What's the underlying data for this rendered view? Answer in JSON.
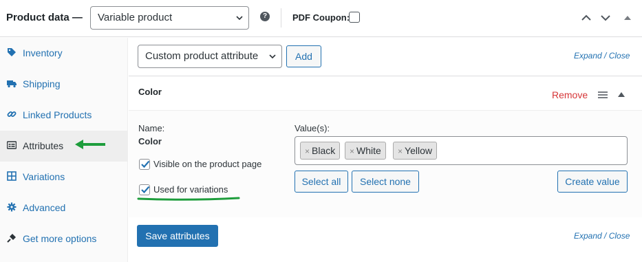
{
  "header": {
    "title": "Product data —",
    "product_type": "Variable product",
    "help_glyph": "?",
    "coupon_label": "PDF Coupon:",
    "coupon_checked": false
  },
  "sidebar": {
    "items": [
      {
        "label": "Inventory",
        "icon": "tag-icon"
      },
      {
        "label": "Shipping",
        "icon": "truck-icon"
      },
      {
        "label": "Linked Products",
        "icon": "link-icon"
      },
      {
        "label": "Attributes",
        "icon": "list-icon",
        "active": true
      },
      {
        "label": "Variations",
        "icon": "grid-icon"
      },
      {
        "label": "Advanced",
        "icon": "gear-icon"
      },
      {
        "label": "Get more options",
        "icon": "plug-icon"
      }
    ]
  },
  "toolbar": {
    "attribute_select": "Custom product attribute",
    "add_label": "Add",
    "expand_close": "Expand / Close"
  },
  "attribute": {
    "title": "Color",
    "remove_label": "Remove",
    "name_label": "Name:",
    "name_value": "Color",
    "values_label": "Value(s):",
    "values": [
      "Black",
      "White",
      "Yellow"
    ],
    "tag_remove_glyph": "×",
    "visible_label": "Visible on the product page",
    "visible_checked": true,
    "variations_label": "Used for variations",
    "variations_checked": true,
    "select_all": "Select all",
    "select_none": "Select none",
    "create_value": "Create value"
  },
  "footer": {
    "save_label": "Save attributes",
    "expand_close": "Expand / Close"
  },
  "colors": {
    "link": "#2271b1",
    "remove": "#d63638",
    "annotation_green": "#1e9d3c"
  }
}
